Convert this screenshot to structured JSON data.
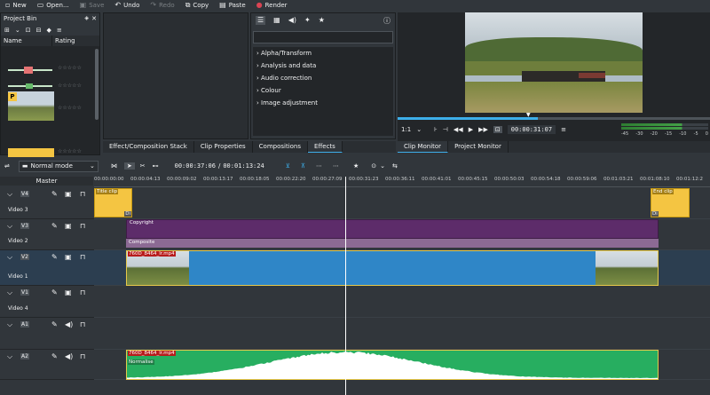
{
  "toolbar": {
    "new": "New",
    "open": "Open...",
    "save": "Save",
    "undo": "Undo",
    "redo": "Redo",
    "copy": "Copy",
    "paste": "Paste",
    "render": "Render"
  },
  "bin": {
    "title": "Project Bin",
    "col_name": "Name",
    "col_rating": "Rating"
  },
  "effects": {
    "items": [
      "Alpha/Transform",
      "Analysis and data",
      "Audio correction",
      "Colour",
      "Image adjustment"
    ]
  },
  "tabs_left": [
    "Effect/Composition Stack",
    "Clip Properties",
    "Compositions",
    "Effects"
  ],
  "monitor": {
    "zoom": "1:1",
    "timecode": "00:00:31:07",
    "meter_labels": [
      "-45",
      "-30",
      "-20",
      "-15",
      "-10",
      "-5",
      "0"
    ],
    "tabs": [
      "Clip Monitor",
      "Project Monitor"
    ]
  },
  "timeline": {
    "mode": "Normal mode",
    "position": "00:00:37:06",
    "duration": "00:01:13:24",
    "master": "Master",
    "ruler": [
      "00:00:00:00",
      "00:00:04:13",
      "00:00:09:02",
      "00:00:13:17",
      "00:00:18:05",
      "00:00:22:20",
      "00:00:27:09",
      "00:00:31:23",
      "00:00:36:11",
      "00:00:41:01",
      "00:00:45:15",
      "00:00:50:03",
      "00:00:54:18",
      "00:00:59:06",
      "00:01:03:21",
      "00:01:08:10",
      "00:01:12:2"
    ]
  },
  "tracks": [
    {
      "id": "V4",
      "name": "Video 3"
    },
    {
      "id": "V3",
      "name": "Video 2"
    },
    {
      "id": "V2",
      "name": "Video 1"
    },
    {
      "id": "V1",
      "name": "Video 4"
    },
    {
      "id": "A1",
      "name": ""
    },
    {
      "id": "A2",
      "name": ""
    }
  ],
  "clips": {
    "title_clip": "Title clip",
    "end_clip": "End clip",
    "copyright": "Copyright",
    "composite": "Composite",
    "video_clip": "760D_8464_lr.mp4",
    "audio_clip": "760D_8464_lr.mp4",
    "normalise": "Normalise",
    "di": "Di"
  }
}
